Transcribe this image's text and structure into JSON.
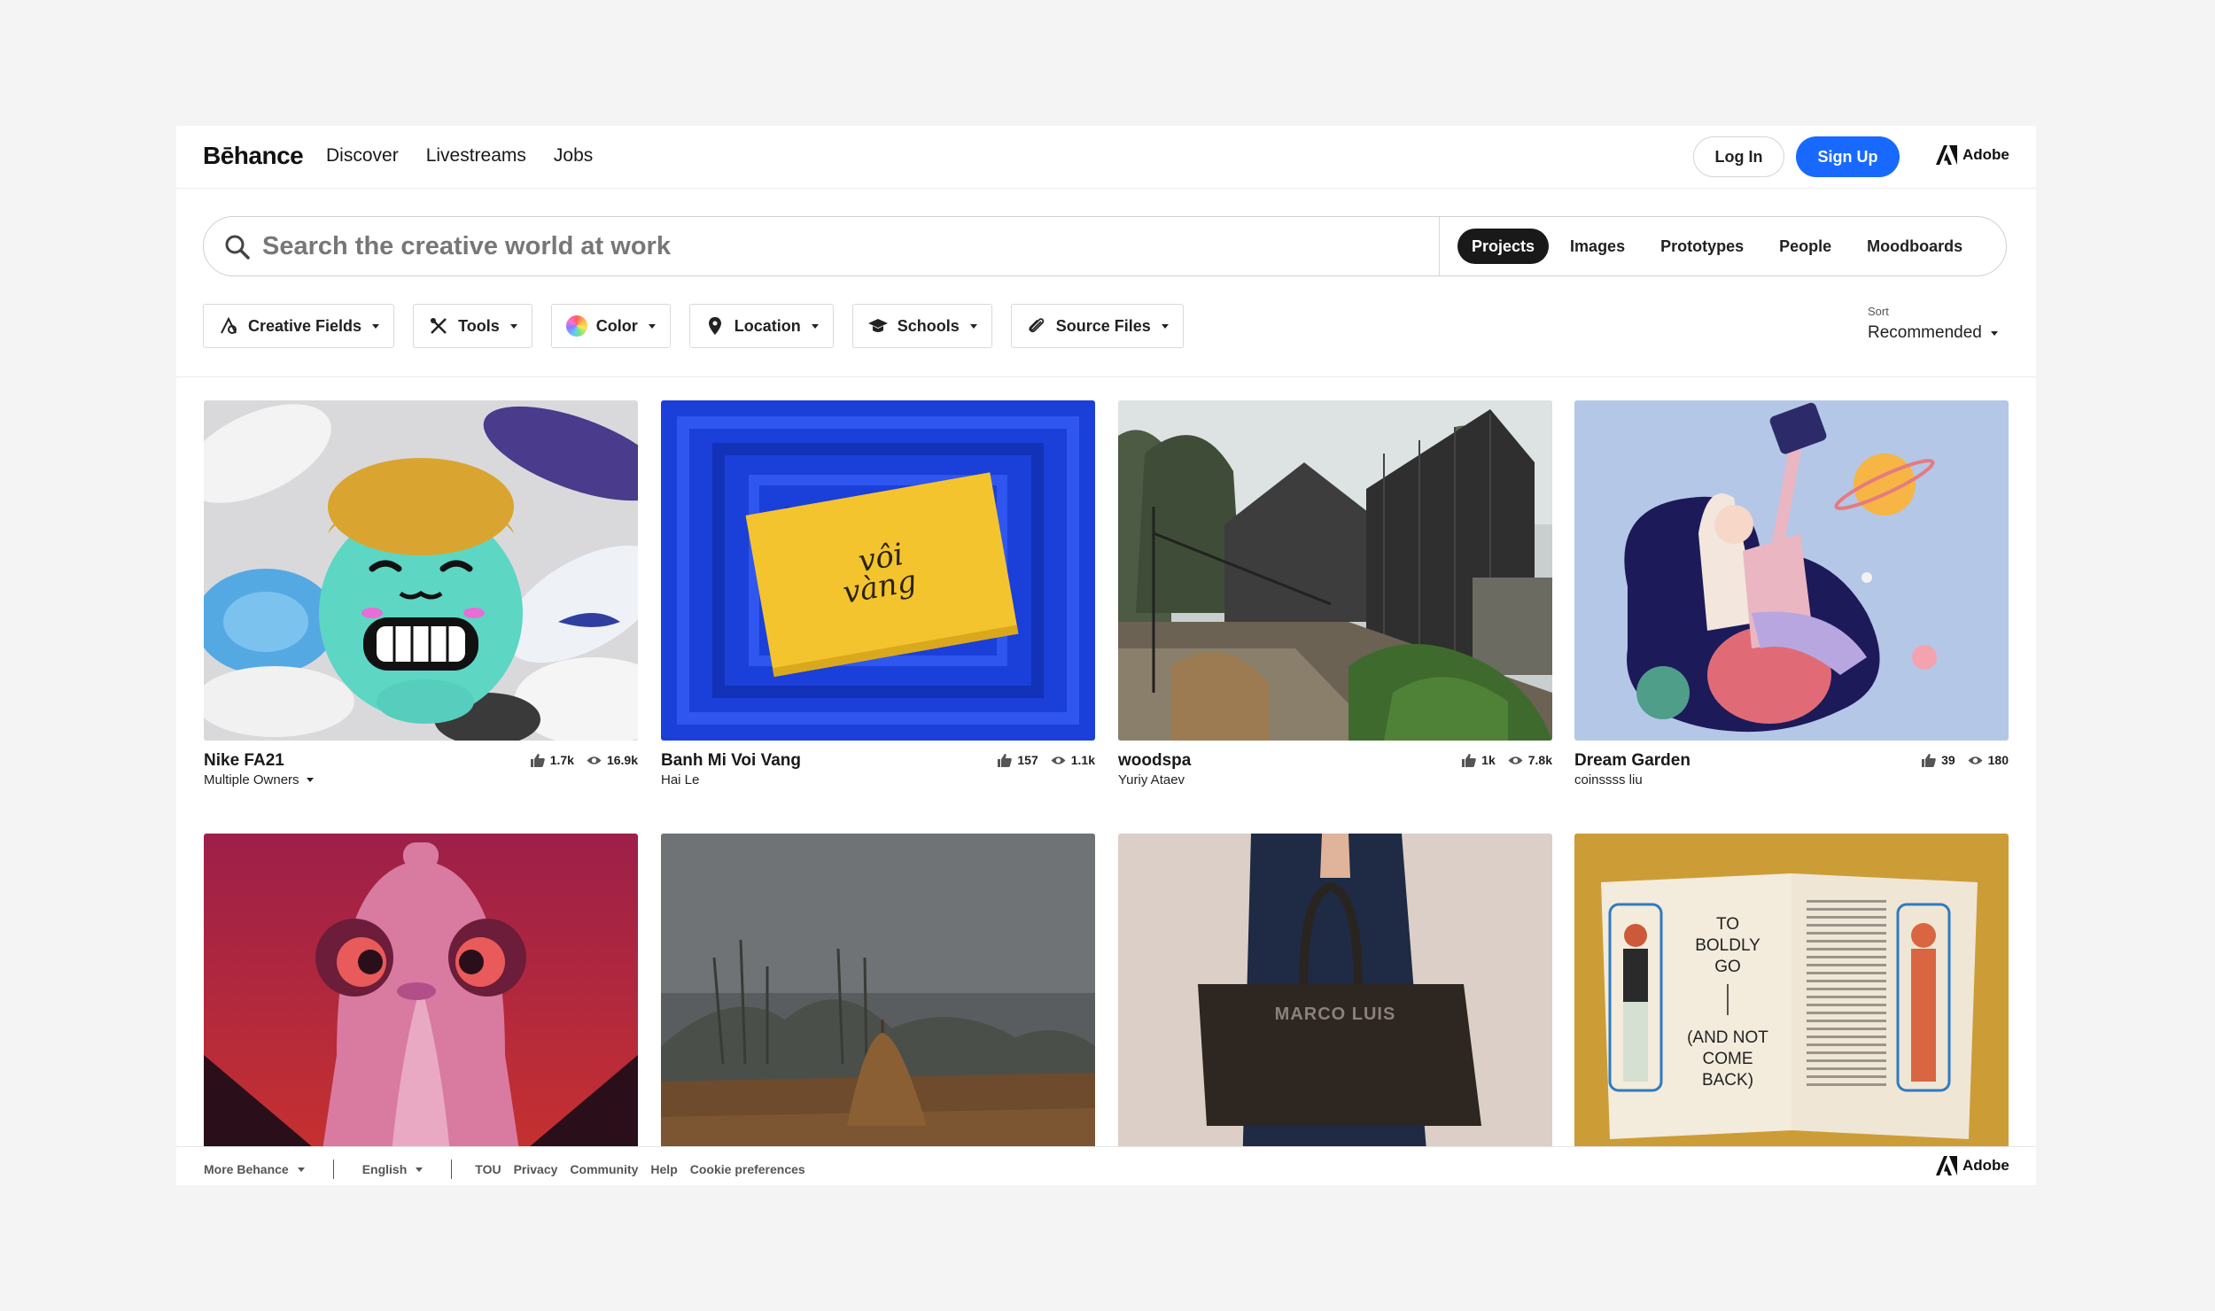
{
  "header": {
    "logo": "Bēhance",
    "nav": [
      "Discover",
      "Livestreams",
      "Jobs"
    ],
    "login_label": "Log In",
    "signup_label": "Sign Up",
    "adobe_label": "Adobe"
  },
  "search": {
    "placeholder": "Search the creative world at work",
    "tabs": [
      "Projects",
      "Images",
      "Prototypes",
      "People",
      "Moodboards"
    ],
    "active_tab": "Projects"
  },
  "filters": {
    "items": [
      "Creative Fields",
      "Tools",
      "Color",
      "Location",
      "Schools",
      "Source Files"
    ],
    "sort_label": "Sort",
    "sort_value": "Recommended"
  },
  "projects": [
    {
      "title": "Nike FA21",
      "owner": "Multiple Owners",
      "likes": "1.7k",
      "views": "16.9k"
    },
    {
      "title": "Banh Mi Voi Vang",
      "owner": "Hai Le",
      "likes": "157",
      "views": "1.1k"
    },
    {
      "title": "woodspa",
      "owner": "Yuriy Ataev",
      "likes": "1k",
      "views": "7.8k"
    },
    {
      "title": "Dream Garden",
      "owner": "coinssss liu",
      "likes": "39",
      "views": "180"
    }
  ],
  "artwork_text": {
    "card_text_top": "vôi",
    "card_text_bottom": "vàng",
    "bag_text": "MARCO LUIS",
    "book_lines_1": [
      "TO",
      "BOLDLY",
      "GO"
    ],
    "book_lines_2": [
      "(AND NOT",
      "COME",
      "BACK)"
    ]
  },
  "footer": {
    "more_label": "More Behance",
    "language": "English",
    "links": [
      "TOU",
      "Privacy",
      "Community",
      "Help",
      "Cookie preferences"
    ],
    "adobe_label": "Adobe"
  },
  "colors": {
    "accent": "#1769ff",
    "active_tab_bg": "#191919"
  }
}
